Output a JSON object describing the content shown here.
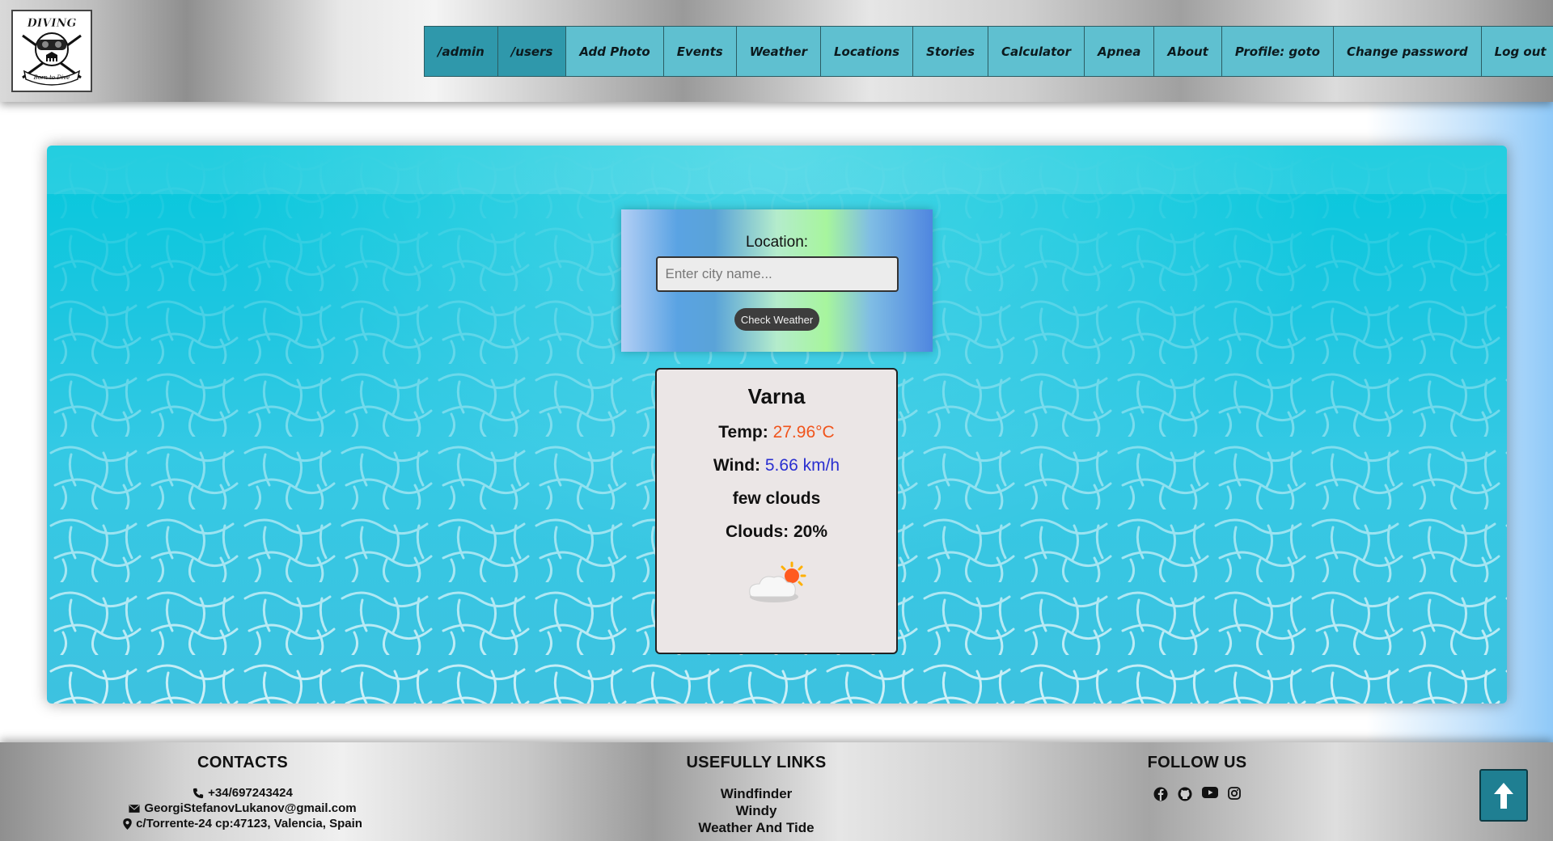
{
  "header": {
    "logo_icon": "diving-skull-logo-icon",
    "logo_text": "DIVING",
    "logo_motto": "Born to Dive",
    "nav": [
      {
        "label": "/admin",
        "active": true
      },
      {
        "label": "/users",
        "active": true
      },
      {
        "label": "Add Photo"
      },
      {
        "label": "Events"
      },
      {
        "label": "Weather"
      },
      {
        "label": "Locations"
      },
      {
        "label": "Stories"
      },
      {
        "label": "Calculator"
      },
      {
        "label": "Apnea"
      },
      {
        "label": "About"
      },
      {
        "label": "Profile: goto"
      },
      {
        "label": "Change password"
      },
      {
        "label": "Log out"
      }
    ]
  },
  "search": {
    "label": "Location:",
    "placeholder": "Enter city name...",
    "value": "",
    "button_label": "Check Weather"
  },
  "weather": {
    "city": "Varna",
    "temp_label": "Temp:",
    "temp_value": "27.96°C",
    "wind_label": "Wind:",
    "wind_value": "5.66 km/h",
    "description": "few clouds",
    "clouds_label": "Clouds:",
    "clouds_value": "20%",
    "icon": "few-clouds-icon"
  },
  "footer": {
    "contacts": {
      "title": "CONTACTS",
      "phone": "+34/697243424",
      "email": "GeorgiStefanovLukanov@gmail.com",
      "address": "c/Torrente-24 cp:47123, Valencia, Spain"
    },
    "links": {
      "title": "USEFULLY LINKS",
      "items": [
        "Windfinder",
        "Windy",
        "Weather And Tide"
      ]
    },
    "follow": {
      "title": "FOLLOW US",
      "icons": [
        "facebook-icon",
        "github-icon",
        "youtube-icon",
        "instagram-icon"
      ]
    },
    "scroll_top_icon": "arrow-up-icon"
  },
  "colors": {
    "nav_bg": "#5fc0d0",
    "nav_active_bg": "#2f98ab",
    "temp_value": "#f0541c",
    "wind_value": "#2a2fd0",
    "water": "#1dc6e0",
    "scroll_top_bg": "#1f7f92"
  }
}
